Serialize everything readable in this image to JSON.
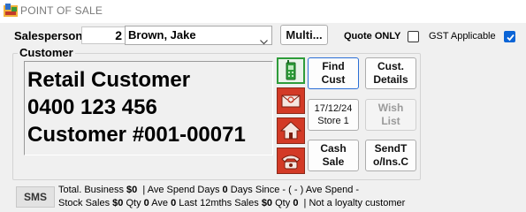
{
  "window": {
    "title": "POINT OF SALE"
  },
  "salesperson": {
    "label": "Salesperson",
    "number": "2",
    "name": "Brown, Jake"
  },
  "buttons": {
    "multi": "Multi...",
    "find_line1": "Find",
    "find_line2": "Cust",
    "details_line1": "Cust.",
    "details_line2": "Details",
    "date_line1": "17/12/24",
    "date_line2": "Store 1",
    "wish_line1": "Wish",
    "wish_line2": "List",
    "cash_line1": "Cash",
    "cash_line2": "Sale",
    "send_line1": "SendT",
    "send_line2": "o/Ins.C",
    "sms": "SMS"
  },
  "options": {
    "quote_only_label": "Quote ONLY",
    "quote_only_checked": false,
    "gst_label": "GST Applicable",
    "gst_checked": true
  },
  "customer": {
    "group_label": "Customer",
    "line1": "Retail Customer",
    "line2": "0400 123 456",
    "line3": "Customer #001-00071"
  },
  "side_icons": [
    "mobile-phone-icon",
    "email-icon",
    "home-icon",
    "telephone-icon"
  ],
  "stats": {
    "total_business_label": "Total. Business",
    "total_business": "$0",
    "ave_spend_days_label": "Ave Spend Days",
    "ave_spend_days": "0",
    "days_since_label": "Days Since -",
    "days_since": "( - )",
    "ave_spend_label": "Ave Spend -",
    "stock_sales_label": "Stock Sales",
    "stock_sales": "$0",
    "qty_label": "Qty",
    "qty": "0",
    "ave_label": "Ave",
    "ave": "0",
    "last12_label": "Last 12mths Sales",
    "last12": "$0",
    "qty2_label": "Qty",
    "qty2": "0",
    "loyalty_text": "Not a loyalty customer"
  },
  "colors": {
    "accent": "#0a64d6",
    "icon_red": "#d33a26",
    "phone_green": "#2e9c3a"
  }
}
